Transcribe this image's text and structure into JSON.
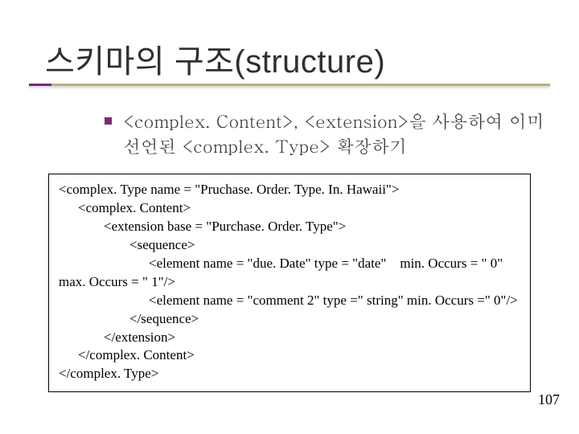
{
  "title": "스키마의 구조(structure)",
  "bullet": "<complex. Content>, <extension>을 사용하여 이미 선언된 <complex. Type> 확장하기",
  "code": {
    "l1": "<complex. Type name = \"Pruchase. Order. Type. In. Hawaii\">",
    "l2": "<complex. Content>",
    "l3": "<extension base = \"Purchase. Order. Type\">",
    "l4": "<sequence>",
    "l5": "<element name = \"due. Date\" type = \"date\"    min. Occurs = \" 0\"",
    "l6": "max. Occurs = \" 1\"/>",
    "l7": "<element name = \"comment 2\" type =\" string\" min. Occurs =\" 0\"/>",
    "l8": "</sequence>",
    "l9": "</extension>",
    "l10": "</complex. Content>",
    "l11": "</complex. Type>"
  },
  "page_number": "107"
}
